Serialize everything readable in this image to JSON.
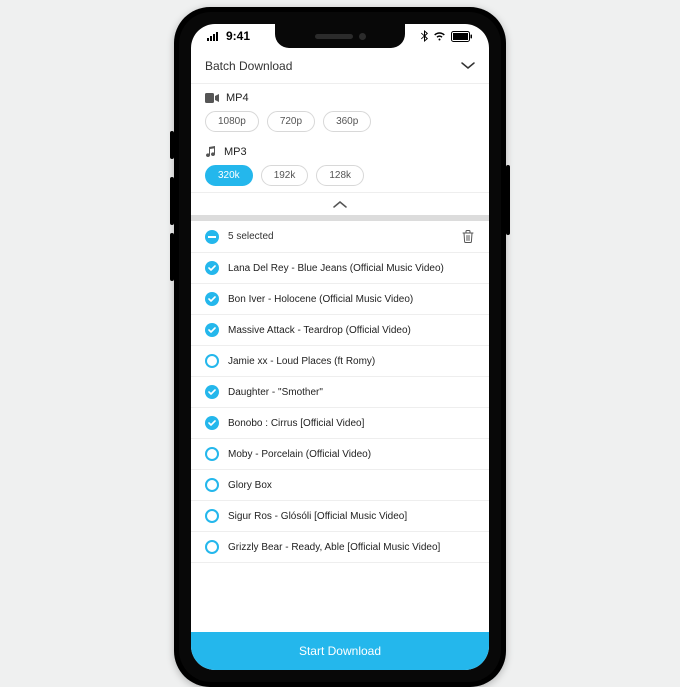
{
  "status": {
    "time": "9:41"
  },
  "header": {
    "title": "Batch Download"
  },
  "formats": {
    "mp4": {
      "label": "MP4",
      "options": [
        "1080p",
        "720p",
        "360p"
      ],
      "active": null
    },
    "mp3": {
      "label": "MP3",
      "options": [
        "320k",
        "192k",
        "128k"
      ],
      "active": "320k"
    }
  },
  "selection": {
    "count_label": "5 selected"
  },
  "tracks": [
    {
      "title": "Lana Del Rey - Blue Jeans (Official Music Video)",
      "checked": true
    },
    {
      "title": "Bon Iver - Holocene (Official Music Video)",
      "checked": true
    },
    {
      "title": "Massive Attack - Teardrop (Official Video)",
      "checked": true
    },
    {
      "title": "Jamie xx - Loud Places (ft Romy)",
      "checked": false
    },
    {
      "title": "Daughter - \"Smother\"",
      "checked": true
    },
    {
      "title": "Bonobo : Cirrus [Official Video]",
      "checked": true
    },
    {
      "title": "Moby - Porcelain (Official Video)",
      "checked": false
    },
    {
      "title": "Glory Box",
      "checked": false
    },
    {
      "title": "Sigur Ros - Glósóli [Official Music Video]",
      "checked": false
    },
    {
      "title": "Grizzly Bear - Ready, Able [Official Music Video]",
      "checked": false
    }
  ],
  "cta": {
    "label": "Start Download"
  },
  "colors": {
    "accent": "#24b7ec"
  }
}
